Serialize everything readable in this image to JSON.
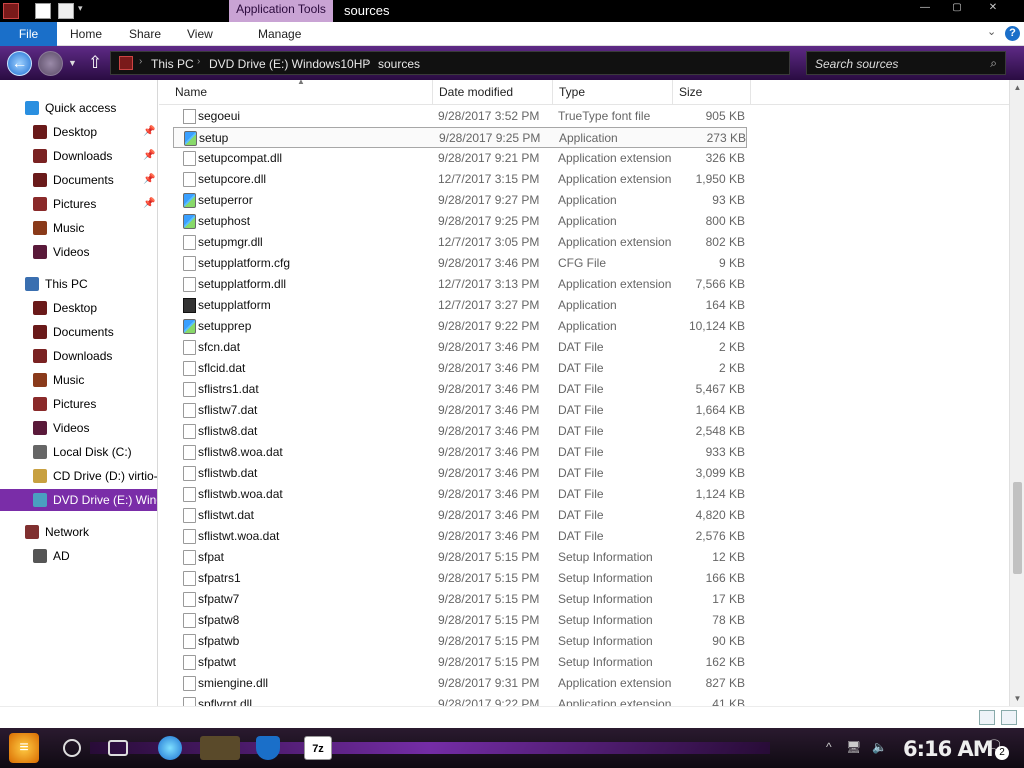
{
  "titlebar": {
    "context_tab": "Application Tools",
    "window_title": "sources",
    "minimize": "—",
    "maximize": "▢",
    "close": "✕"
  },
  "ribbon": {
    "tabs": [
      "File",
      "Home",
      "Share",
      "View",
      "Manage"
    ],
    "help": "?"
  },
  "address": {
    "crumbs": [
      "This PC",
      "DVD Drive (E:) Windows10HP",
      "sources"
    ]
  },
  "search": {
    "placeholder": "Search sources"
  },
  "sidebar": {
    "items": [
      {
        "label": "Quick access",
        "icon": "star-icon",
        "pinned": false
      },
      {
        "label": "Desktop",
        "icon": "desktop-icon",
        "pinned": true
      },
      {
        "label": "Downloads",
        "icon": "downloads-icon",
        "pinned": true
      },
      {
        "label": "Documents",
        "icon": "documents-icon",
        "pinned": true
      },
      {
        "label": "Pictures",
        "icon": "pictures-icon",
        "pinned": true
      },
      {
        "label": "Music",
        "icon": "music-icon",
        "pinned": false
      },
      {
        "label": "Videos",
        "icon": "videos-icon",
        "pinned": false
      },
      {
        "label": "This PC",
        "icon": "computer-icon",
        "pinned": false
      },
      {
        "label": "Desktop",
        "icon": "desktop-icon",
        "pinned": false
      },
      {
        "label": "Documents",
        "icon": "documents-icon",
        "pinned": false
      },
      {
        "label": "Downloads",
        "icon": "downloads-icon",
        "pinned": false
      },
      {
        "label": "Music",
        "icon": "music-icon",
        "pinned": false
      },
      {
        "label": "Pictures",
        "icon": "pictures-icon",
        "pinned": false
      },
      {
        "label": "Videos",
        "icon": "videos-icon",
        "pinned": false
      },
      {
        "label": "Local Disk (C:)",
        "icon": "hard-drive-icon",
        "pinned": false
      },
      {
        "label": "CD Drive (D:) virtio-w",
        "icon": "cd-drive-icon",
        "pinned": false
      },
      {
        "label": "DVD Drive (E:) Wind",
        "icon": "dvd-drive-icon",
        "pinned": false,
        "selected": true
      },
      {
        "label": "Network",
        "icon": "network-icon",
        "pinned": false
      },
      {
        "label": "AD",
        "icon": "network-computer-icon",
        "pinned": false
      }
    ]
  },
  "columns": {
    "name": "Name",
    "date": "Date modified",
    "type": "Type",
    "size": "Size"
  },
  "files": [
    {
      "name": "segoeui",
      "date": "9/28/2017 3:52 PM",
      "type": "TrueType font file",
      "size": "905 KB",
      "icon": "font-file-icon"
    },
    {
      "name": "setup",
      "date": "9/28/2017 9:25 PM",
      "type": "Application",
      "size": "273 KB",
      "icon": "setup-app-icon",
      "selected": true
    },
    {
      "name": "setupcompat.dll",
      "date": "9/28/2017 9:21 PM",
      "type": "Application extension",
      "size": "326 KB",
      "icon": "dll-file-icon"
    },
    {
      "name": "setupcore.dll",
      "date": "12/7/2017 3:15 PM",
      "type": "Application extension",
      "size": "1,950 KB",
      "icon": "dll-file-icon"
    },
    {
      "name": "setuperror",
      "date": "9/28/2017 9:27 PM",
      "type": "Application",
      "size": "93 KB",
      "icon": "setup-app-icon"
    },
    {
      "name": "setuphost",
      "date": "9/28/2017 9:25 PM",
      "type": "Application",
      "size": "800 KB",
      "icon": "setup-app-icon"
    },
    {
      "name": "setupmgr.dll",
      "date": "12/7/2017 3:05 PM",
      "type": "Application extension",
      "size": "802 KB",
      "icon": "dll-file-icon"
    },
    {
      "name": "setupplatform.cfg",
      "date": "9/28/2017 3:46 PM",
      "type": "CFG File",
      "size": "9 KB",
      "icon": "generic-file-icon"
    },
    {
      "name": "setupplatform.dll",
      "date": "12/7/2017 3:13 PM",
      "type": "Application extension",
      "size": "7,566 KB",
      "icon": "dll-file-icon"
    },
    {
      "name": "setupplatform",
      "date": "12/7/2017 3:27 PM",
      "type": "Application",
      "size": "164 KB",
      "icon": "console-app-icon"
    },
    {
      "name": "setupprep",
      "date": "9/28/2017 9:22 PM",
      "type": "Application",
      "size": "10,124 KB",
      "icon": "setup-app-icon"
    },
    {
      "name": "sfcn.dat",
      "date": "9/28/2017 3:46 PM",
      "type": "DAT File",
      "size": "2 KB",
      "icon": "generic-file-icon"
    },
    {
      "name": "sflcid.dat",
      "date": "9/28/2017 3:46 PM",
      "type": "DAT File",
      "size": "2 KB",
      "icon": "generic-file-icon"
    },
    {
      "name": "sflistrs1.dat",
      "date": "9/28/2017 3:46 PM",
      "type": "DAT File",
      "size": "5,467 KB",
      "icon": "generic-file-icon"
    },
    {
      "name": "sflistw7.dat",
      "date": "9/28/2017 3:46 PM",
      "type": "DAT File",
      "size": "1,664 KB",
      "icon": "generic-file-icon"
    },
    {
      "name": "sflistw8.dat",
      "date": "9/28/2017 3:46 PM",
      "type": "DAT File",
      "size": "2,548 KB",
      "icon": "generic-file-icon"
    },
    {
      "name": "sflistw8.woa.dat",
      "date": "9/28/2017 3:46 PM",
      "type": "DAT File",
      "size": "933 KB",
      "icon": "generic-file-icon"
    },
    {
      "name": "sflistwb.dat",
      "date": "9/28/2017 3:46 PM",
      "type": "DAT File",
      "size": "3,099 KB",
      "icon": "generic-file-icon"
    },
    {
      "name": "sflistwb.woa.dat",
      "date": "9/28/2017 3:46 PM",
      "type": "DAT File",
      "size": "1,124 KB",
      "icon": "generic-file-icon"
    },
    {
      "name": "sflistwt.dat",
      "date": "9/28/2017 3:46 PM",
      "type": "DAT File",
      "size": "4,820 KB",
      "icon": "generic-file-icon"
    },
    {
      "name": "sflistwt.woa.dat",
      "date": "9/28/2017 3:46 PM",
      "type": "DAT File",
      "size": "2,576 KB",
      "icon": "generic-file-icon"
    },
    {
      "name": "sfpat",
      "date": "9/28/2017 5:15 PM",
      "type": "Setup Information",
      "size": "12 KB",
      "icon": "setup-info-icon"
    },
    {
      "name": "sfpatrs1",
      "date": "9/28/2017 5:15 PM",
      "type": "Setup Information",
      "size": "166 KB",
      "icon": "setup-info-icon"
    },
    {
      "name": "sfpatw7",
      "date": "9/28/2017 5:15 PM",
      "type": "Setup Information",
      "size": "17 KB",
      "icon": "setup-info-icon"
    },
    {
      "name": "sfpatw8",
      "date": "9/28/2017 5:15 PM",
      "type": "Setup Information",
      "size": "78 KB",
      "icon": "setup-info-icon"
    },
    {
      "name": "sfpatwb",
      "date": "9/28/2017 5:15 PM",
      "type": "Setup Information",
      "size": "90 KB",
      "icon": "setup-info-icon"
    },
    {
      "name": "sfpatwt",
      "date": "9/28/2017 5:15 PM",
      "type": "Setup Information",
      "size": "162 KB",
      "icon": "setup-info-icon"
    },
    {
      "name": "smiengine.dll",
      "date": "9/28/2017 9:31 PM",
      "type": "Application extension",
      "size": "827 KB",
      "icon": "dll-file-icon"
    },
    {
      "name": "spflvrnt.dll",
      "date": "9/28/2017 9:22 PM",
      "type": "Application extension",
      "size": "41 KB",
      "icon": "dll-file-icon"
    }
  ],
  "taskbar": {
    "clock": "6:16 AM",
    "notification_count": "2",
    "apps": [
      "edge-icon",
      "file-explorer-icon",
      "defender-icon",
      "7zip-icon"
    ],
    "sevenzip_label": "7z"
  },
  "colors": {
    "accent": "#7a2da8",
    "ribbon_file": "#1a6fc9",
    "context_tab": "#c9a3d4"
  }
}
